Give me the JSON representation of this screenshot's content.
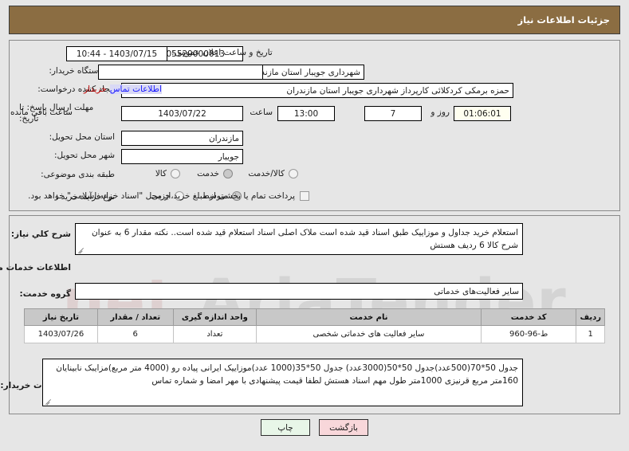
{
  "header": {
    "title": "جزئیات اطلاعات نیاز"
  },
  "colors": {
    "header_bg": "#8b6d42",
    "page_bg": "#e6e6e6",
    "link_blue": "#1a1aff",
    "link_red": "#c00000",
    "back_btn_bg": "#f8d7da",
    "print_btn_bg": "#e8f6e8",
    "table_header_bg": "#c8c8c8",
    "countdown_bg": "#fffff0"
  },
  "watermark": {
    "text": "AriaTender",
    "suffix": ".net"
  },
  "form": {
    "need_number": {
      "label": "شماره نیاز:",
      "value": "1103005529000013"
    },
    "announce_datetime": {
      "label": "تاریخ و ساعت اعلان عمومی:",
      "value": "1403/07/15 - 10:44"
    },
    "buyer_org": {
      "label": "نام دستگاه خریدار:",
      "value": "شهرداری جویبار استان مازندران"
    },
    "buyer_org_secondary": {
      "label": "",
      "value": ""
    },
    "request_creator": {
      "label": "ایجاد کننده درخواست:",
      "value": "حمزه برمکی کردکلائی کارپرداز شهرداری جویبار استان مازندران"
    },
    "buyer_contact_link": {
      "label_blue": "اطلاعات تماس",
      "label_red": "خریدار"
    },
    "buyer_org_city": {
      "value": "شهرداری جویبار استان مازندران"
    },
    "deadline": {
      "label": "مهلت ارسال پاسخ: تا تاریخ:",
      "date": "1403/07/22",
      "time_label": "ساعت",
      "time": "13:00",
      "days": "7",
      "days_label": "روز و",
      "countdown": "01:06:01",
      "countdown_label": "ساعت باقي مانده"
    },
    "delivery_province": {
      "label": "استان محل تحویل:",
      "value": "مازندران"
    },
    "delivery_city": {
      "label": "شهر محل تحویل:",
      "value": "جویبار"
    },
    "subject_category": {
      "label": "طبقه بندی موضوعی:",
      "options": [
        {
          "label": "کالا",
          "selected": false
        },
        {
          "label": "خدمت",
          "selected": true
        },
        {
          "label": "کالا/خدمت",
          "selected": false
        }
      ]
    },
    "purchase_process": {
      "label": "نوع فرآیند خرید :",
      "options": [
        {
          "label": "جزیی",
          "selected": false
        },
        {
          "label": "متوسط",
          "selected": true
        }
      ],
      "checkbox_label": "پرداخت تمام یا بخشی از مبلغ خرید،از محل \"اسناد خزانه اسلامی\" خواهد بود.",
      "checkbox_checked": false
    }
  },
  "need_summary": {
    "label": "شرح كلي نياز:",
    "value": "استعلام خرید جداول و موزاییک طبق اسناد قید شده است ملاک اصلی اسناد  استعلام قید شده است.. نکته مقدار 6 به عنوان شرح کالا 6 ردیف  هستش"
  },
  "services_section": {
    "heading": "اطلاعات خدمات مورد نیاز",
    "service_group": {
      "label": "گروه خدمت:",
      "value": "سایر فعالیت‌های خدماتی"
    }
  },
  "table": {
    "columns": [
      "ردیف",
      "کد خدمت",
      "نام خدمت",
      "واحد اندازه گیری",
      "تعداد / مقدار",
      "تاریخ نیاز"
    ],
    "rows": [
      {
        "row_no": "1",
        "service_code": "ط-96-960",
        "service_name": "سایر فعالیت های خدماتی شخصی",
        "unit": "تعداد",
        "quantity": "6",
        "need_date": "1403/07/26"
      }
    ]
  },
  "buyer_notes": {
    "label": "توضیحات خریدار:",
    "value": "جدول 50*70(500عدد)جدول 50*50(3000عدد) جدول 50*35(1000 عدد)موزاییک ایرانی پیاده رو (4000 متر مربع)مزایبک نابینایان 160متر مربع قرنیزی 1000متر طول مهم اسناد هستش لطفا قیمت پیشنهادی با مهر امضا و شماره تماس"
  },
  "footer": {
    "back_button": "بازگشت",
    "print_button": "چاپ"
  }
}
